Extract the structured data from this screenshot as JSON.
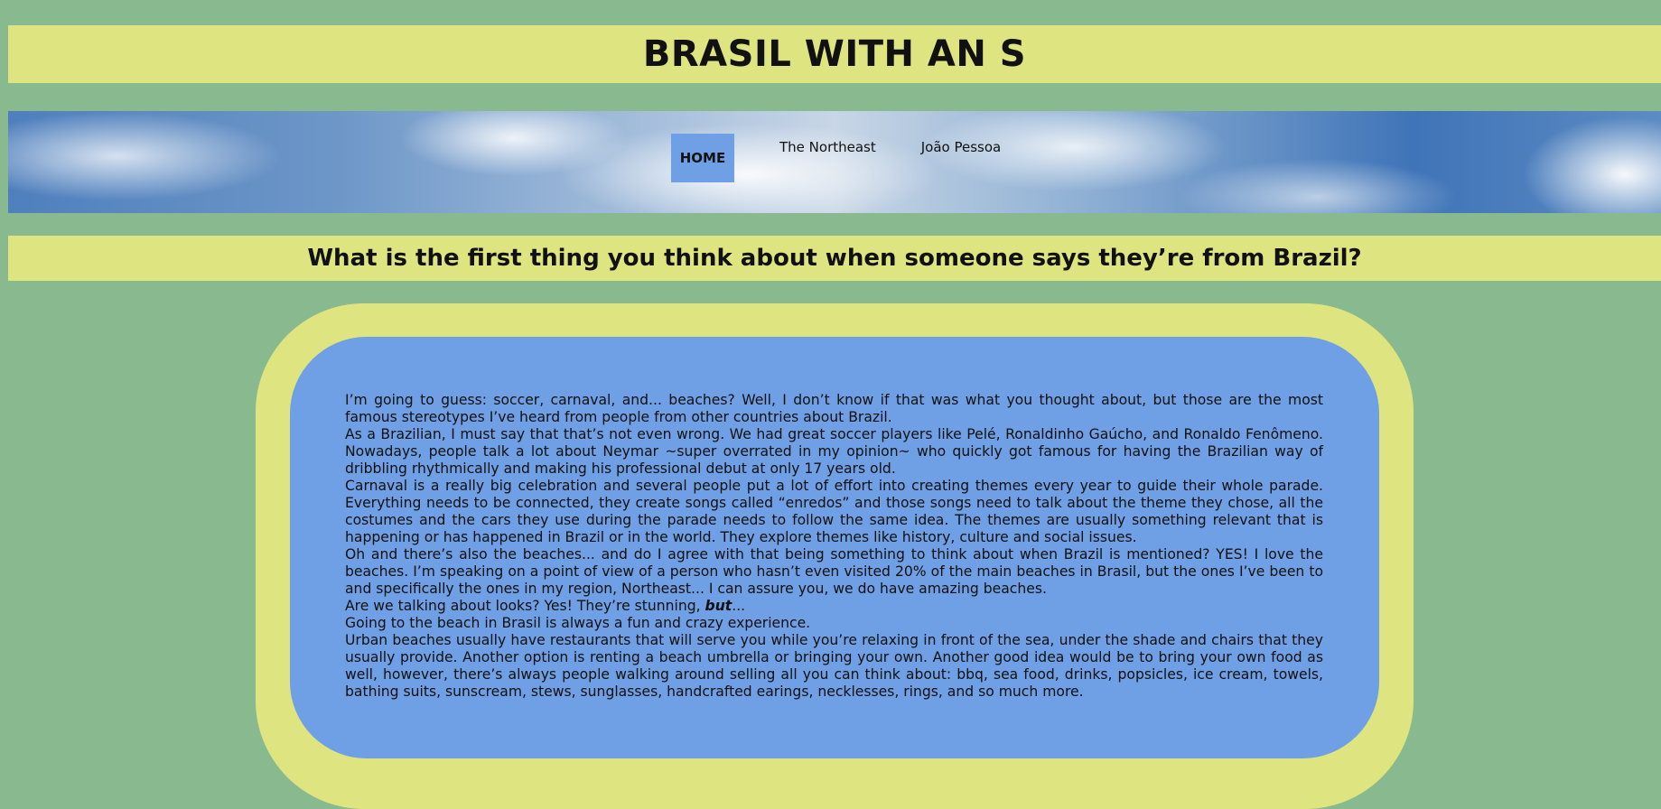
{
  "header": {
    "title": "BRASIL WITH AN S"
  },
  "nav": {
    "items": [
      {
        "label": "HOME",
        "active": true
      },
      {
        "label": "The Northeast",
        "active": false
      },
      {
        "label": "João Pessoa",
        "active": false
      }
    ]
  },
  "section": {
    "question": "What is the first thing you think about when someone says they’re from Brazil?"
  },
  "article": {
    "p1": "I’m going to guess: soccer, carnaval, and... beaches? Well, I don’t know if that was what you thought about, but those are the most famous stereotypes I’ve heard from people from other countries about Brazil.",
    "p2": "As a Brazilian, I must say that that’s not even wrong. We had great soccer players like Pelé, Ronaldinho Gaúcho, and Ronaldo Fenômeno. Nowadays, people talk a lot about Neymar ~super overrated in my opinion~ who quickly got famous for having the Brazilian way of dribbling rhythmically and making his professional debut at only 17 years old.",
    "p3": "Carnaval is a really big celebration and several people put a lot of effort into creating themes every year to guide their whole parade. Everything needs to be connected, they create songs called “enredos” and those songs need to talk about the theme they chose, all the costumes and the cars they use during the parade needs to follow the same idea. The themes are usually something relevant that is happening or has happened in Brazil or in the world. They explore themes like history, culture and social issues.",
    "p4": "Oh and there’s also the beaches... and do I agree with that being something to think about when Brazil is mentioned? YES! I love the beaches. I’m speaking on a point of view of a person who hasn’t even visited 20% of the main beaches in Brasil, but the ones I’ve been to and specifically the ones in my region, Northeast... I can assure you, we do have amazing beaches.",
    "p5_prefix": "Are we talking about looks? Yes! They’re stunning, ",
    "p5_emph": "but",
    "p5_suffix": "...",
    "p6": "Going to the beach in Brasil is always a fun and crazy experience.",
    "p7": "Urban beaches usually have restaurants that will serve you while you’re relaxing in front of the sea, under the shade and chairs that they usually provide. Another option is renting a beach umbrella or bringing your own. Another good idea would be to bring your own food as well, however, there’s always people walking around selling all you can think about: bbq, sea food, drinks, popsicles, ice cream, towels, bathing suits, sunscream, stews, sunglasses, handcrafted earings, necklesses, rings, and so much more."
  },
  "colors": {
    "background": "#89b98f",
    "bar_yellow": "#dee47f",
    "panel_blue": "#6f9fe4"
  }
}
